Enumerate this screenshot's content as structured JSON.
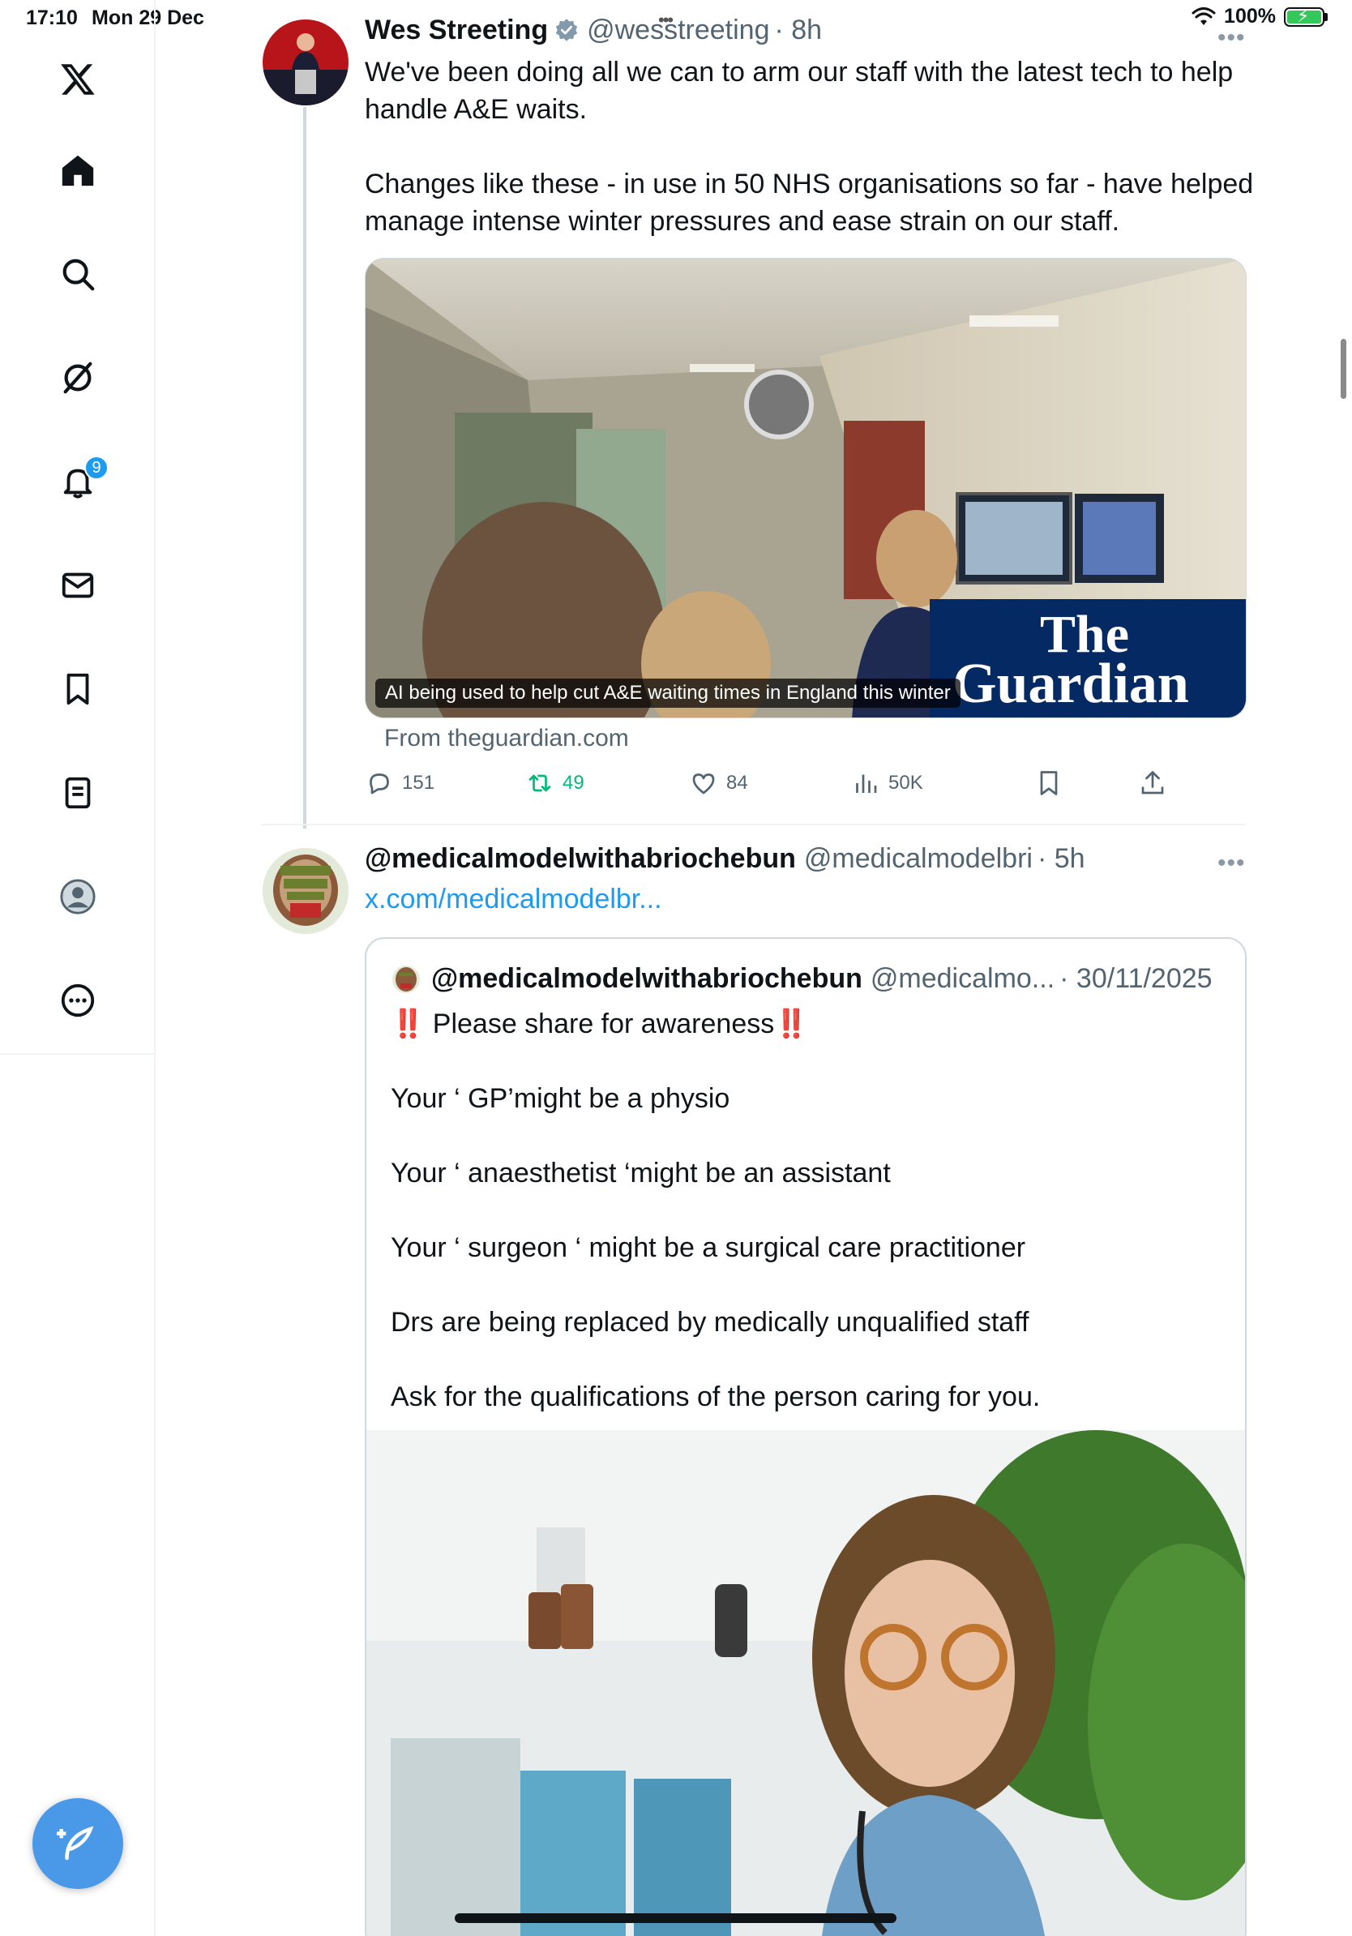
{
  "status_bar": {
    "time": "17:10",
    "date": "Mon 29 Dec",
    "battery": "100%",
    "dots": "•••"
  },
  "sidebar": {
    "items": [
      {
        "name": "x-logo-icon"
      },
      {
        "name": "home-icon"
      },
      {
        "name": "search-icon"
      },
      {
        "name": "grok-icon"
      },
      {
        "name": "notifications-bell-icon",
        "badge": "9"
      },
      {
        "name": "messages-envelope-icon"
      },
      {
        "name": "bookmarks-icon"
      },
      {
        "name": "lists-icon"
      },
      {
        "name": "profile-icon"
      },
      {
        "name": "more-icon"
      }
    ],
    "compose": "compose-post-icon"
  },
  "tweet1": {
    "name": "Wes Streeting",
    "handle": "@wesstreeting",
    "time": "· 8h",
    "more": "•••",
    "body": [
      "We've been doing all we can to arm our staff with the latest tech to help handle A&E waits.",
      "Changes like these - in use in 50 NHS organisations so far - have helped manage intense winter pressures and ease strain on our staff."
    ],
    "card": {
      "caption": "AI being used to help cut A&E waiting times in England this winter",
      "logo_line1": "The",
      "logo_line2": "Guardian",
      "source": "From theguardian.com"
    },
    "actions": {
      "replies": "151",
      "reposts": "49",
      "likes": "84",
      "views": "50K"
    }
  },
  "tweet2": {
    "name": "@medicalmodelwithabriochebun",
    "handle": "@medicalmodelbri",
    "time": "· 5h",
    "more": "•••",
    "link": "x.com/medicalmodelbr...",
    "quote": {
      "name": "@medicalmodelwithabriochebun",
      "handle": "@medicalmo...",
      "time": "· 30/11/2025",
      "body": [
        "‼️ Please share for awareness‼️",
        "Your ‘ GP’might be a physio",
        "Your ‘ anaesthetist ‘might be an assistant",
        "Your ‘ surgeon ‘ might be a surgical care practitioner",
        "Drs are being replaced by medically unqualified staff",
        "Ask for the qualifications of the person caring for you."
      ]
    }
  },
  "colors": {
    "accent": "#1d9bf0",
    "repost_green": "#00ba7c",
    "guardian_blue": "#052962"
  }
}
